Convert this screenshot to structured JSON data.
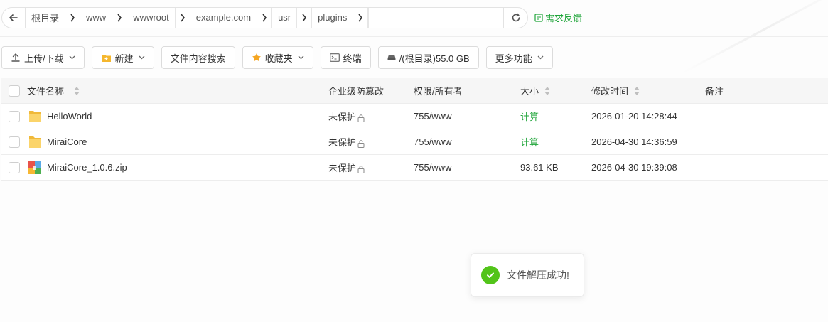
{
  "address_bar": {
    "crumbs": [
      "根目录",
      "www",
      "wwwroot",
      "example.com",
      "usr",
      "plugins"
    ],
    "feedback_label": "需求反馈"
  },
  "toolbar": {
    "upload_label": "上传/下载",
    "new_label": "新建",
    "search_content_label": "文件内容搜索",
    "favorites_label": "收藏夹",
    "terminal_label": "终端",
    "disk_label": "/(根目录)55.0 GB",
    "more_label": "更多功能"
  },
  "table": {
    "headers": {
      "name": "文件名称",
      "protect": "企业级防篡改",
      "perm": "权限/所有者",
      "size": "大小",
      "mtime": "修改时间",
      "note": "备注"
    },
    "rows": [
      {
        "name": "HelloWorld",
        "type": "folder",
        "protect": "未保护",
        "perm": "755/www",
        "size": "计算",
        "mtime": "2026-01-20 14:28:44",
        "note": ""
      },
      {
        "name": "MiraiCore",
        "type": "folder",
        "protect": "未保护",
        "perm": "755/www",
        "size": "计算",
        "mtime": "2026-04-30 14:36:59",
        "note": ""
      },
      {
        "name": "MiraiCore_1.0.6.zip",
        "type": "zip",
        "protect": "未保护",
        "perm": "755/www",
        "size": "93.61 KB",
        "mtime": "2026-04-30 19:39:08",
        "note": ""
      }
    ]
  },
  "toast": {
    "message": "文件解压成功!"
  },
  "colors": {
    "accent_green": "#20a53a",
    "success": "#52c41a",
    "folder": "#f7c64c"
  }
}
